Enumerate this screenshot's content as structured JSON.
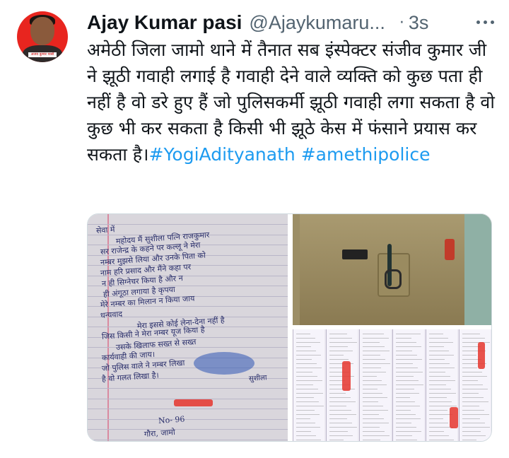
{
  "user": {
    "display_name": "Ajay Kumar pasi",
    "handle": "@Ajaykumaru...",
    "time": "3s",
    "avatar_caption": "अजय कुमार पासी"
  },
  "tweet": {
    "text": "अमेठी जिला जामो थाने में तैनात सब इंस्पेक्टर संजीव कुमार जी ने झूठी गवाही लगाई है गवाही देने वाले व्यक्ति को कुछ पता ही नहीं है वो डरे हुए हैं जो पुलिसकर्मी झूठी गवाही लगा सकता है वो कुछ भी कर सकता है किसी भी झूठे केस में फंसाने प्रयास कर सकता है।",
    "hashtags": [
      "#YogiAdityanath",
      "#amethipolice"
    ]
  },
  "media": {
    "letter_lines": [
      "सेवा में",
      "महोदय मैं सुशीला पत्नि राजकुमार",
      "सर राजेन्द्र के कहने पर कल्लू ने मेरा",
      "नम्बर मुझसे लिया और उनके पिता को",
      "नाम हरि प्रसाद और मैंने कहा पर",
      "न ही सिग्नेचर किया है और न",
      "ही अंगूठा लगाया है कृपया",
      "मेरे नम्बर का मिलान न किया जाय",
      "धन्यवाद",
      "मेरा इससे कोई लेना-देना नहीं है",
      "जिस किसी ने मेरा नम्बर यूज किया है",
      "उसके खिलाफ सख्त से सख्त",
      "कार्यवाही की जाय।",
      "जो पुलिस वाले ने नम्बर लिखा",
      "है वो गलत लिखा है।",
      "No- 96",
      "गौरा, जामो"
    ],
    "letter_signature": "सुशीला"
  }
}
